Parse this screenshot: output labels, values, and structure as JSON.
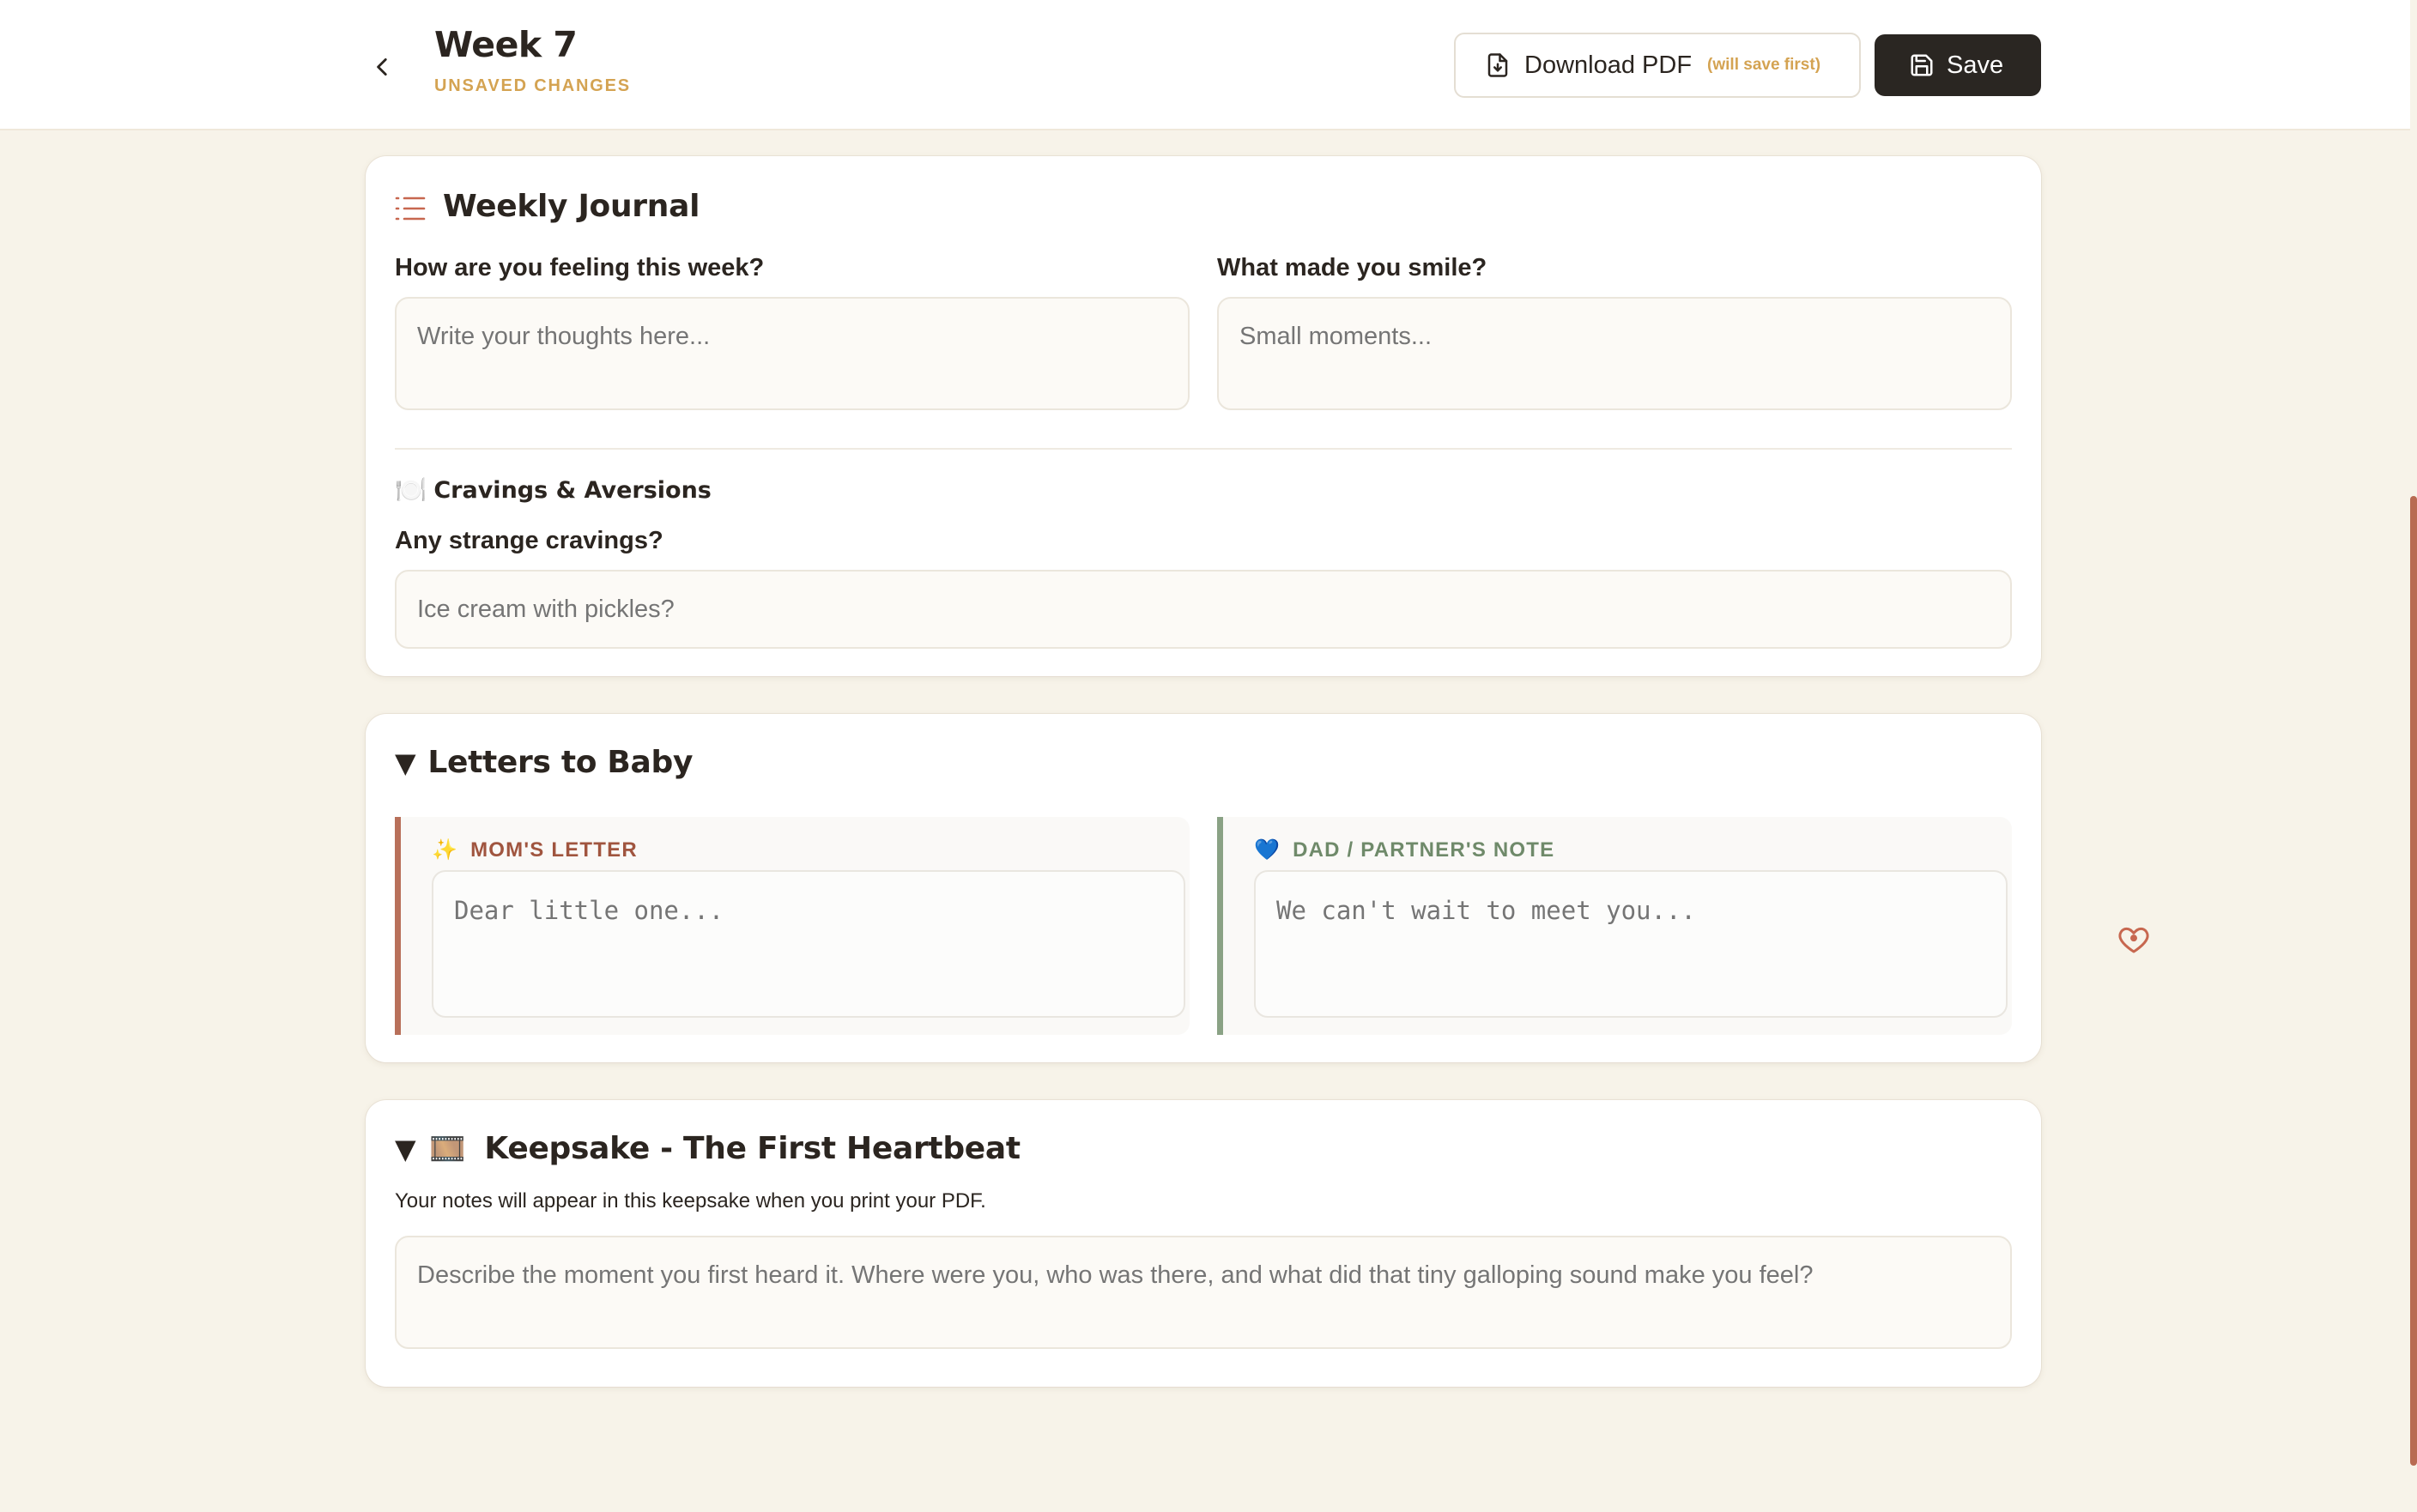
{
  "header": {
    "title": "Week 7",
    "status": "UNSAVED CHANGES",
    "download_label": "Download PDF",
    "download_hint": "(will save first)",
    "save_label": "Save"
  },
  "journal": {
    "title": "Weekly Journal",
    "icon": "list-icon",
    "feeling_label": "How are you feeling this week?",
    "feeling_placeholder": "Write your thoughts here...",
    "smile_label": "What made you smile?",
    "smile_placeholder": "Small moments...",
    "cravings_emoji": "🍽️",
    "cravings_title": "Cravings & Aversions",
    "cravings_label": "Any strange cravings?",
    "cravings_placeholder": "Ice cream with pickles?"
  },
  "letters": {
    "toggle": "▼",
    "title": "Letters to Baby",
    "mom_emoji": "✨",
    "mom_label": "MOM'S LETTER",
    "mom_placeholder": "Dear little one...",
    "dad_emoji": "💙",
    "dad_label": "DAD / PARTNER'S NOTE",
    "dad_placeholder": "We can't wait to meet you..."
  },
  "keepsake": {
    "toggle": "▼",
    "emoji": "🎞️",
    "title": "Keepsake - The First Heartbeat",
    "description": "Your notes will appear in this keepsake when you print your PDF.",
    "placeholder": "Describe the moment you first heard it. Where were you, who was there, and what did that tiny galloping sound make you feel?"
  },
  "colors": {
    "accent_gold": "#d4a352",
    "mom_accent": "#b8705a",
    "dad_accent": "#8aa285",
    "dark_button": "#2a2622",
    "background": "#f7f3e9"
  }
}
